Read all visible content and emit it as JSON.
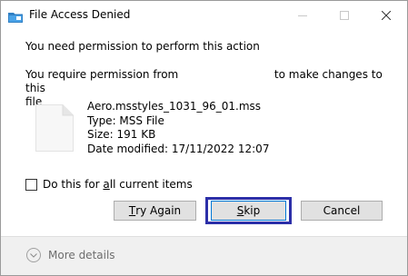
{
  "window": {
    "title": "File Access Denied",
    "title_icon": "folder-warning-icon"
  },
  "titlebar_buttons": {
    "minimize_icon": "minimize-icon",
    "maximize_icon": "maximize-icon",
    "close_icon": "close-icon"
  },
  "dialog": {
    "main_instruction": "You need permission to perform this action",
    "permission_prefix": "You require permission from",
    "permission_suffix": "to make changes to this",
    "permission_wrap": "file"
  },
  "file": {
    "icon": "file-icon",
    "name": "Aero.msstyles_1031_96_01.mss",
    "type": "Type: MSS File",
    "size": "Size: 191 KB",
    "date_modified": "Date modified: 17/11/2022 12:07"
  },
  "options": {
    "apply_all_label_pre": "Do this for ",
    "apply_all_label_key": "a",
    "apply_all_label_post": "ll current items",
    "apply_all_checked": false
  },
  "buttons": {
    "try_again_key": "T",
    "try_again_rest": "ry Again",
    "skip_key": "S",
    "skip_rest": "kip",
    "cancel": "Cancel"
  },
  "footer": {
    "more_details": "More details",
    "expand_icon": "chevron-down-icon"
  },
  "colors": {
    "highlight_border": "#2c2fa8",
    "focus_border": "#0078d7",
    "button_face": "#e1e1e1",
    "footer_bg": "#f0f0f0"
  }
}
